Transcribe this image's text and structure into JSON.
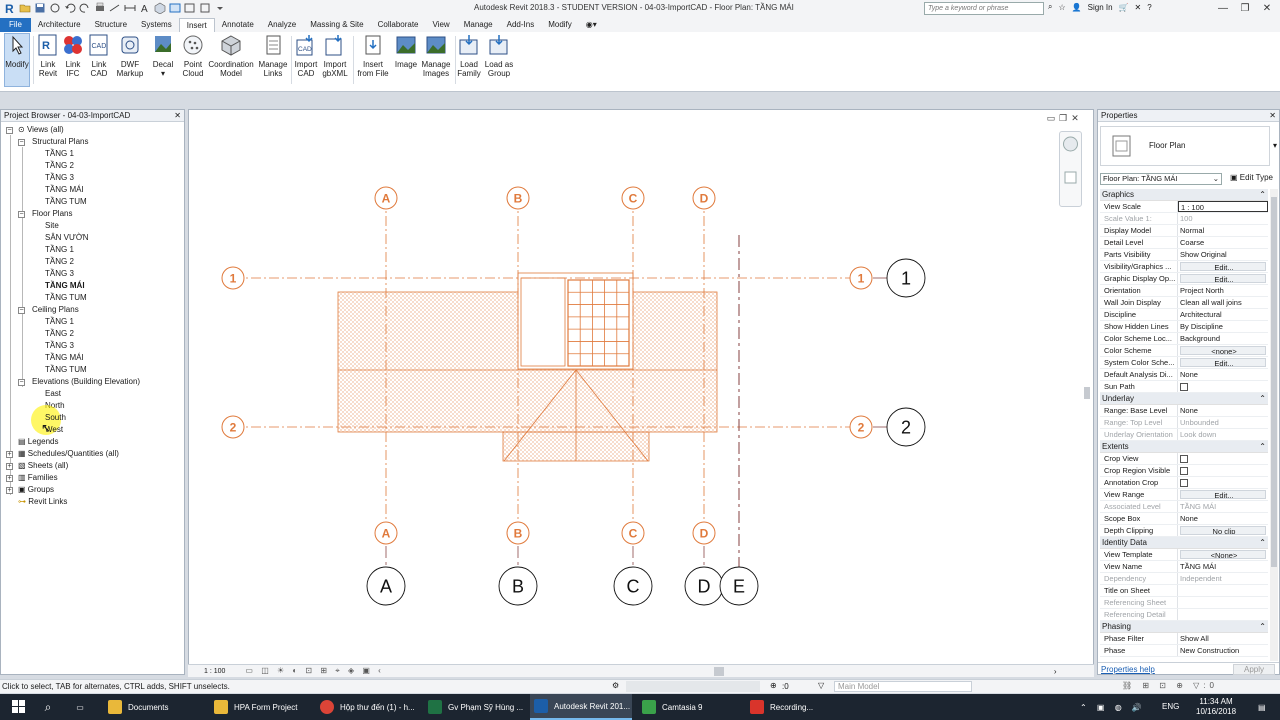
{
  "titlebar": {
    "title": "Autodesk Revit 2018.3 - STUDENT VERSION -     04-03-ImportCAD - Floor Plan: TẦNG MÁI",
    "search_placeholder": "Type a keyword or phrase",
    "sign_in": "Sign In"
  },
  "tabs": [
    "File",
    "Architecture",
    "Structure",
    "Systems",
    "Insert",
    "Annotate",
    "Analyze",
    "Massing & Site",
    "Collaborate",
    "View",
    "Manage",
    "Add-Ins",
    "Modify"
  ],
  "active_tab": "Insert",
  "ribbon": {
    "modify": "Modify",
    "link_revit": [
      "Link",
      "Revit"
    ],
    "link_ifc": [
      "Link",
      "IFC"
    ],
    "link_cad": [
      "Link",
      "CAD"
    ],
    "dwf_markup": [
      "DWF",
      "Markup"
    ],
    "decal": "Decal",
    "point_cloud": [
      "Point",
      "Cloud"
    ],
    "coordination_model": [
      "Coordination",
      "Model"
    ],
    "manage_links": [
      "Manage",
      "Links"
    ],
    "import_cad": [
      "Import",
      "CAD"
    ],
    "import_gbxml": [
      "Import",
      "gbXML"
    ],
    "insert_from_file": [
      "Insert",
      "from File"
    ],
    "image": "Image",
    "manage_images": [
      "Manage",
      "Images"
    ],
    "load_family": [
      "Load",
      "Family"
    ],
    "load_as_group": [
      "Load as",
      "Group"
    ]
  },
  "project_browser": {
    "title": "Project Browser - 04-03-ImportCAD",
    "views_all": "Views (all)",
    "structural_plans": "Structural Plans",
    "structural_items": [
      "TẦNG 1",
      "TẦNG 2",
      "TẦNG 3",
      "TẦNG MÁI",
      "TẦNG TUM"
    ],
    "floor_plans": "Floor Plans",
    "floor_items": [
      "Site",
      "SÂN VƯỜN",
      "TẦNG 1",
      "TẦNG 2",
      "TẦNG 3",
      "TẦNG MÁI",
      "TẦNG TUM"
    ],
    "ceiling_plans": "Ceiling Plans",
    "ceiling_items": [
      "TẦNG 1",
      "TẦNG 2",
      "TẦNG 3",
      "TẦNG MÁI",
      "TẦNG TUM"
    ],
    "elevations": "Elevations (Building Elevation)",
    "elevation_items": [
      "East",
      "North",
      "South",
      "West"
    ],
    "legends": "Legends",
    "schedules": "Schedules/Quantities (all)",
    "sheets": "Sheets (all)",
    "families": "Families",
    "groups": "Groups",
    "revit_links": "Revit Links"
  },
  "drawing": {
    "grid_x_labels": [
      "A",
      "B",
      "C",
      "D",
      "E"
    ],
    "grid_y_labels": [
      "1",
      "2"
    ],
    "cad_grid_x_labels": [
      "A",
      "B",
      "C",
      "D"
    ],
    "cad_grid_y_labels": [
      "1",
      "2"
    ],
    "cad_color": "#e07a3c",
    "scale": "1 : 100"
  },
  "properties": {
    "title": "Properties",
    "type_name": "Floor Plan",
    "instance": "Floor Plan: TẦNG MÁI",
    "edit_type": "Edit Type",
    "groups": [
      {
        "name": "Graphics",
        "rows": [
          [
            "View Scale",
            "1 : 100",
            "box"
          ],
          [
            "Scale Value    1:",
            "100",
            "grey"
          ],
          [
            "Display Model",
            "Normal",
            ""
          ],
          [
            "Detail Level",
            "Coarse",
            ""
          ],
          [
            "Parts Visibility",
            "Show Original",
            ""
          ],
          [
            "Visibility/Graphics ...",
            "Edit...",
            "btn"
          ],
          [
            "Graphic Display Op...",
            "Edit...",
            "btn"
          ],
          [
            "Orientation",
            "Project North",
            ""
          ],
          [
            "Wall Join Display",
            "Clean all wall joins",
            ""
          ],
          [
            "Discipline",
            "Architectural",
            ""
          ],
          [
            "Show Hidden Lines",
            "By Discipline",
            ""
          ],
          [
            "Color Scheme Loc...",
            "Background",
            ""
          ],
          [
            "Color Scheme",
            "<none>",
            "btn"
          ],
          [
            "System Color Sche...",
            "Edit...",
            "btn"
          ],
          [
            "Default Analysis Di...",
            "None",
            ""
          ],
          [
            "Sun Path",
            "",
            "chk"
          ]
        ]
      },
      {
        "name": "Underlay",
        "rows": [
          [
            "Range: Base Level",
            "None",
            ""
          ],
          [
            "Range: Top Level",
            "Unbounded",
            "grey"
          ],
          [
            "Underlay Orientation",
            "Look down",
            "grey"
          ]
        ]
      },
      {
        "name": "Extents",
        "rows": [
          [
            "Crop View",
            "",
            "chk"
          ],
          [
            "Crop Region Visible",
            "",
            "chk"
          ],
          [
            "Annotation Crop",
            "",
            "chk"
          ],
          [
            "View Range",
            "Edit...",
            "btn"
          ],
          [
            "Associated Level",
            "TẦNG MÁI",
            "grey"
          ],
          [
            "Scope Box",
            "None",
            ""
          ],
          [
            "Depth Clipping",
            "No clip",
            "btn"
          ]
        ]
      },
      {
        "name": "Identity Data",
        "rows": [
          [
            "View Template",
            "<None>",
            "btn"
          ],
          [
            "View Name",
            "TẦNG MÁI",
            ""
          ],
          [
            "Dependency",
            "Independent",
            "grey"
          ],
          [
            "Title on Sheet",
            "",
            ""
          ],
          [
            "Referencing Sheet",
            "",
            "grey"
          ],
          [
            "Referencing Detail",
            "",
            "grey"
          ]
        ]
      },
      {
        "name": "Phasing",
        "rows": [
          [
            "Phase Filter",
            "Show All",
            ""
          ],
          [
            "Phase",
            "New Construction",
            ""
          ]
        ]
      }
    ],
    "help": "Properties help",
    "apply": "Apply"
  },
  "status": {
    "text": "Click to select, TAB for alternates, CTRL adds, SHIFT unselects.",
    "zero": ":0",
    "model": "Main Model"
  },
  "taskbar": {
    "items": [
      "Documents",
      "HPA Form Project",
      "Hộp thư đến (1) - h...",
      "Gv Phạm Sỹ Hùng ...",
      "Autodesk Revit 201...",
      "Camtasia 9",
      "Recording..."
    ],
    "lang": "ENG",
    "time": "11:34 AM",
    "date": "10/16/2018"
  }
}
